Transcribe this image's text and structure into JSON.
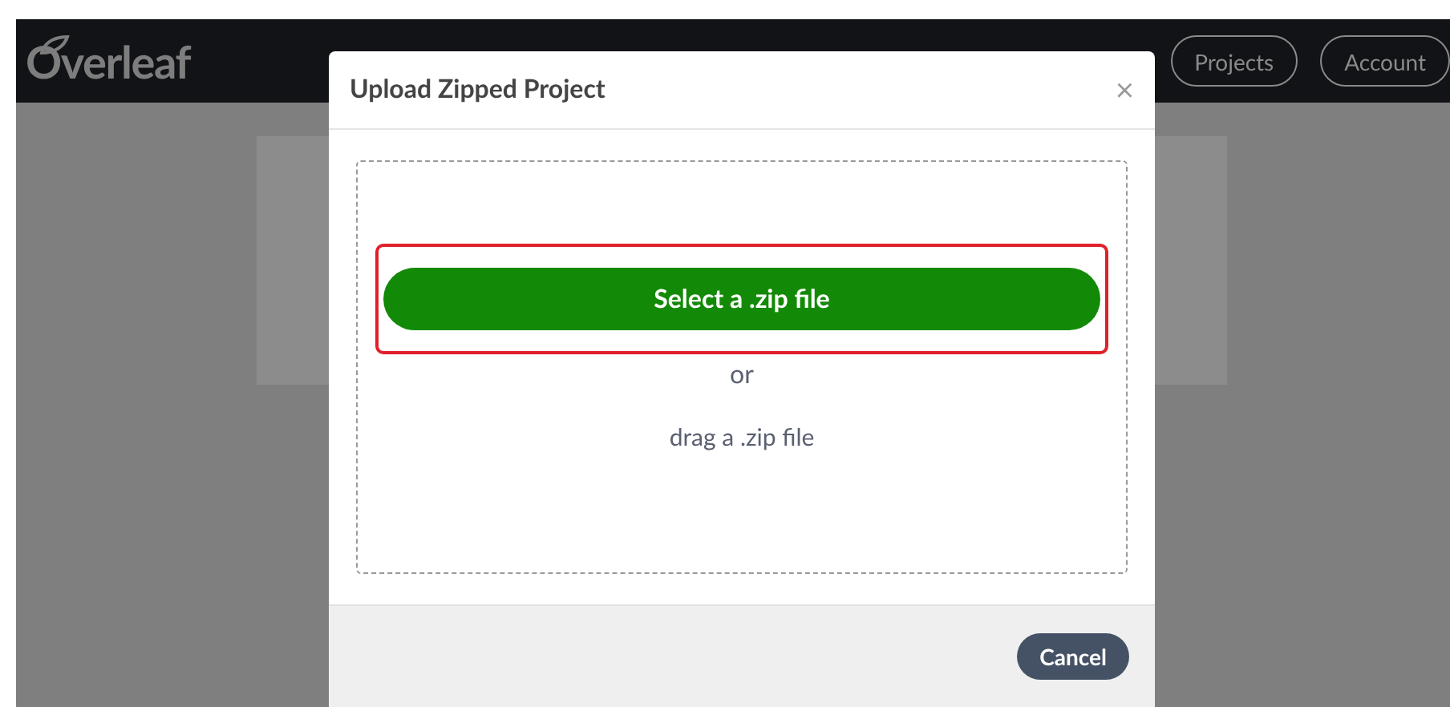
{
  "navbar": {
    "logo": "Overleaf",
    "buttons": [
      "Projects",
      "Account"
    ]
  },
  "modal": {
    "title": "Upload Zipped Project",
    "close": "×",
    "select_button": "Select a .zip file",
    "highlighted": true,
    "separator": "or",
    "drop_hint": "drag a .zip file",
    "cancel_button": "Cancel"
  }
}
